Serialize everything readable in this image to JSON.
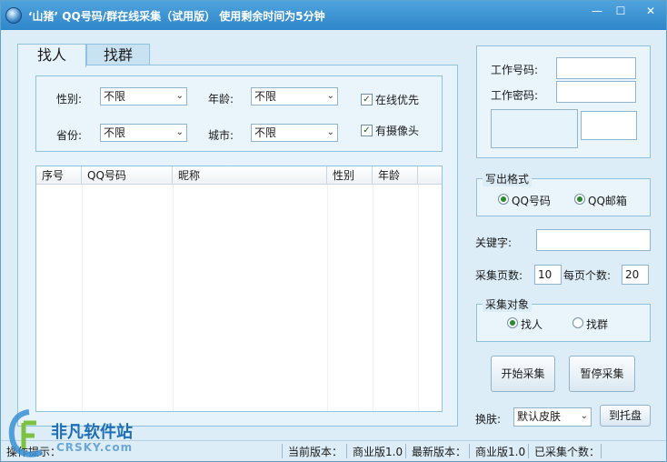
{
  "window": {
    "title": "‘山猪’ QQ号码/群在线采集（试用版） 使用剩余时间为5分钟",
    "min_label": "—",
    "max_label": "☐",
    "close_label": "✕"
  },
  "tabs": [
    {
      "label": "找人",
      "active": true
    },
    {
      "label": "找群",
      "active": false
    }
  ],
  "filters": {
    "gender_label": "性别:",
    "gender_value": "不限",
    "age_label": "年龄:",
    "age_value": "不限",
    "province_label": "省份:",
    "province_value": "不限",
    "city_label": "城市:",
    "city_value": "不限",
    "online_first_label": "在线优先",
    "online_first_checked": true,
    "has_camera_label": "有摄像头",
    "has_camera_checked": true,
    "dropdown_arrow": "⌄"
  },
  "results_table": {
    "columns": [
      "序号",
      "QQ号码",
      "昵称",
      "性别",
      "年龄"
    ],
    "rows": []
  },
  "account": {
    "work_id_label": "工作号码:",
    "work_id_value": "",
    "work_password_label": "工作密码:",
    "work_password_value": "",
    "captcha_value": ""
  },
  "output_format": {
    "title": "写出格式",
    "options": [
      {
        "label": "QQ号码",
        "selected": true
      },
      {
        "label": "QQ邮箱",
        "selected": true
      }
    ]
  },
  "keyword": {
    "label": "关键字:",
    "value": ""
  },
  "paging": {
    "pages_label": "采集页数:",
    "pages_value": "10",
    "per_page_label": "每页个数:",
    "per_page_value": "20"
  },
  "target": {
    "title": "采集对象",
    "options": [
      {
        "label": "找人",
        "selected": true
      },
      {
        "label": "找群",
        "selected": false
      }
    ]
  },
  "actions": {
    "start_label": "开始采集",
    "pause_label": "暂停采集",
    "tray_label": "到托盘"
  },
  "skin": {
    "label": "换肤:",
    "value": "默认皮肤"
  },
  "status_bar": {
    "message": "操作提示：",
    "current_version_label": "当前版本：",
    "current_version_value": "商业版1.0",
    "latest_version_label": "最新版本：",
    "latest_version_value": "商业版1.0",
    "collected_label": "已采集个数："
  },
  "watermark": {
    "brand": "非凡软件站",
    "sub": "CRSKY.com"
  }
}
